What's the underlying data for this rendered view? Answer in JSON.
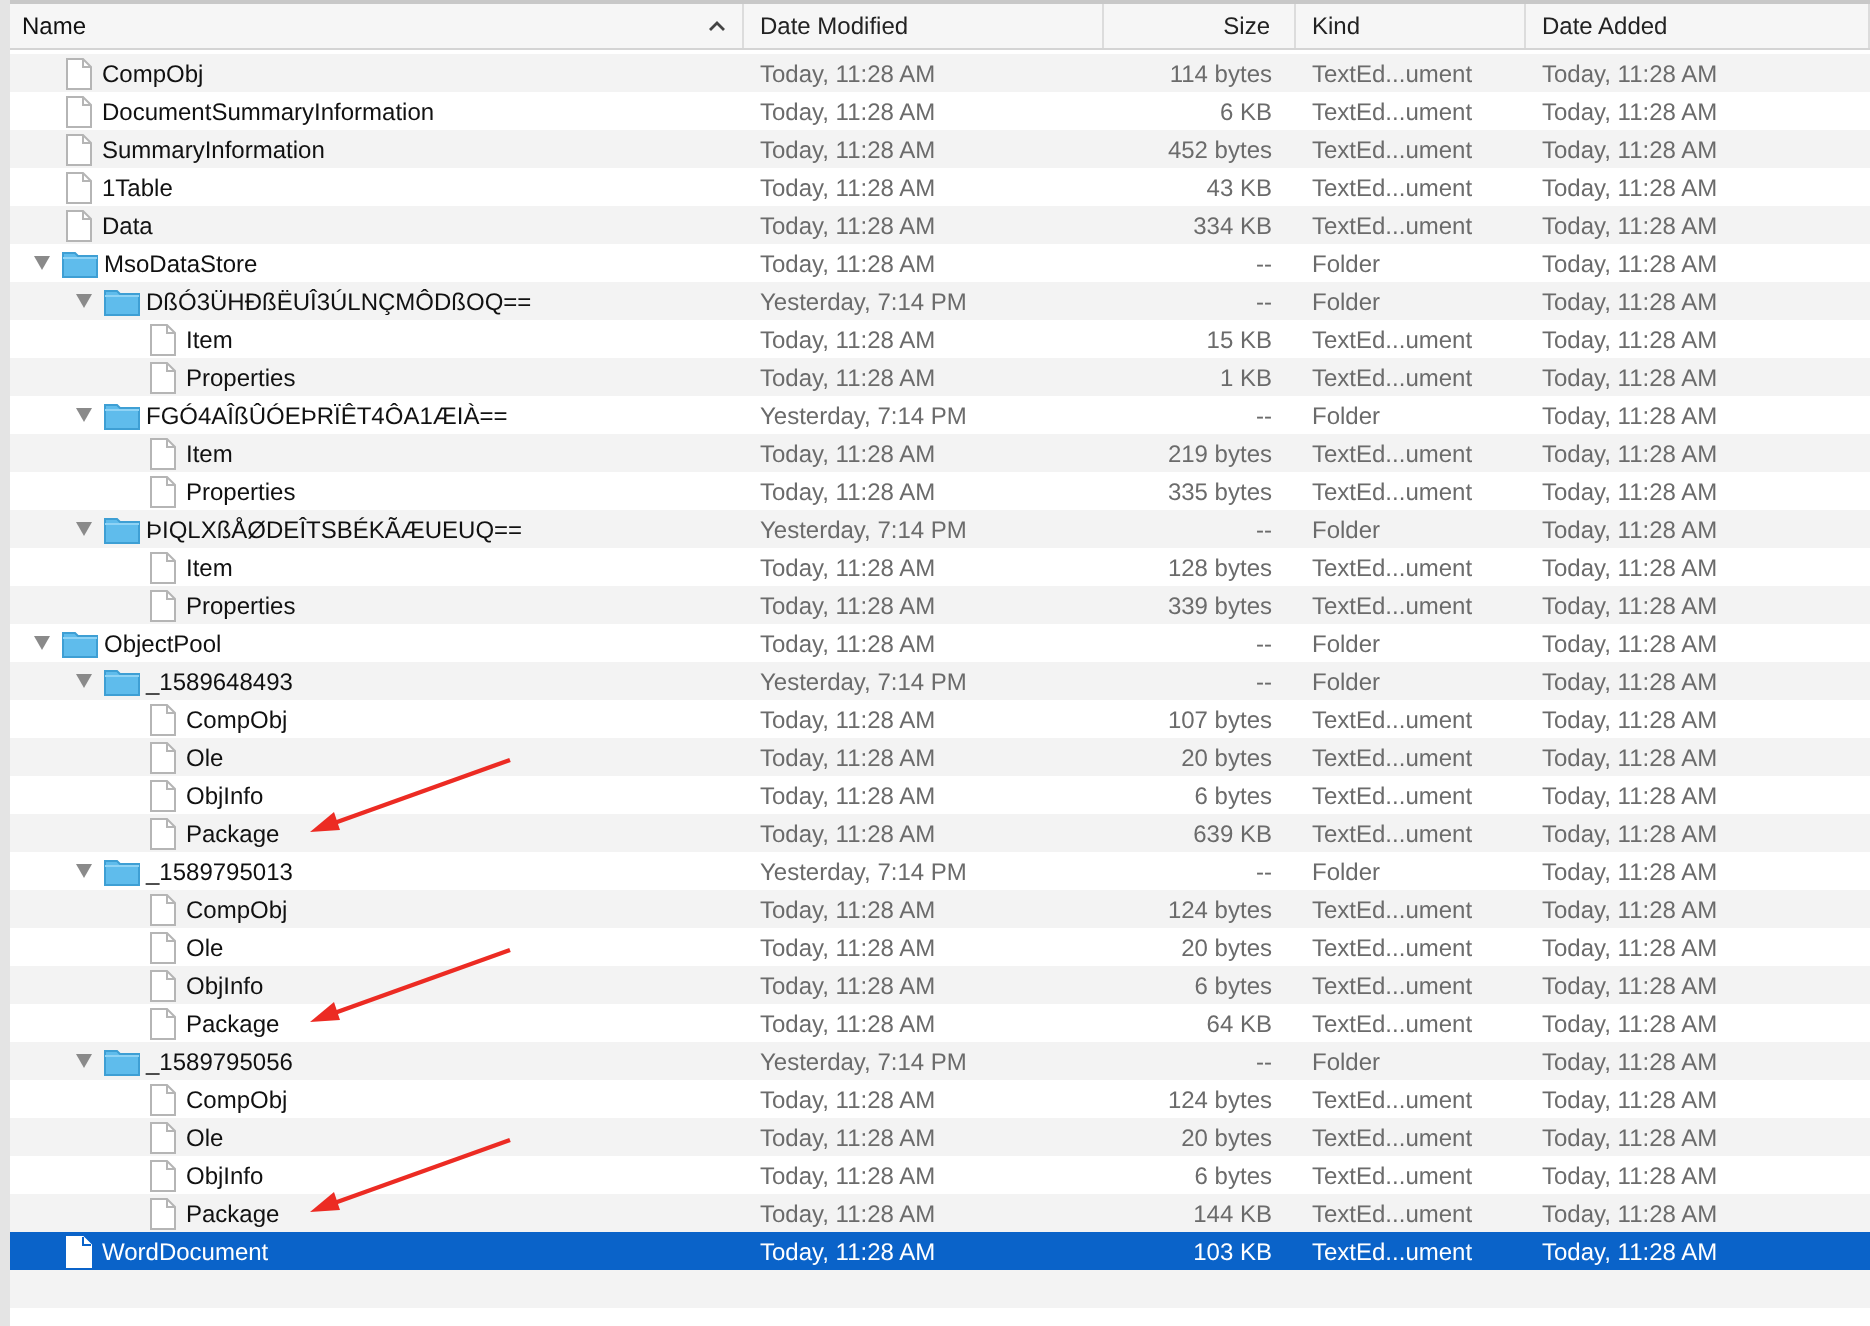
{
  "table": {
    "columns": [
      {
        "label": "Name",
        "sorted": true
      },
      {
        "label": "Date Modified",
        "sorted": false
      },
      {
        "label": "Size",
        "sorted": false
      },
      {
        "label": "Kind",
        "sorted": false
      },
      {
        "label": "Date Added",
        "sorted": false
      }
    ],
    "rows": [
      {
        "kind": "file",
        "name": "CompObj",
        "modified": "Today, 11:28 AM",
        "size": "114 bytes",
        "type": "TextEd...ument",
        "added": "Today, 11:28 AM",
        "selected": false
      },
      {
        "kind": "file",
        "name": "DocumentSummaryInformation",
        "modified": "Today, 11:28 AM",
        "size": "6 KB",
        "type": "TextEd...ument",
        "added": "Today, 11:28 AM",
        "selected": false
      },
      {
        "kind": "file",
        "name": "SummaryInformation",
        "modified": "Today, 11:28 AM",
        "size": "452 bytes",
        "type": "TextEd...ument",
        "added": "Today, 11:28 AM",
        "selected": false
      },
      {
        "kind": "file",
        "name": "1Table",
        "modified": "Today, 11:28 AM",
        "size": "43 KB",
        "type": "TextEd...ument",
        "added": "Today, 11:28 AM",
        "selected": false
      },
      {
        "kind": "file",
        "name": "Data",
        "modified": "Today, 11:28 AM",
        "size": "334 KB",
        "type": "TextEd...ument",
        "added": "Today, 11:28 AM",
        "selected": false
      },
      {
        "kind": "folder",
        "name": "MsoDataStore",
        "modified": "Today, 11:28 AM",
        "size": "--",
        "type": "Folder",
        "added": "Today, 11:28 AM",
        "selected": false,
        "expanded": true,
        "children": [
          {
            "kind": "folder",
            "name": "DßÓ3ÜHÐßËUÎ3ÚLNÇMÔDßOQ==",
            "modified": "Yesterday, 7:14 PM",
            "size": "--",
            "type": "Folder",
            "added": "Today, 11:28 AM",
            "selected": false,
            "expanded": true,
            "children": [
              {
                "kind": "file",
                "name": "Item",
                "modified": "Today, 11:28 AM",
                "size": "15 KB",
                "type": "TextEd...ument",
                "added": "Today, 11:28 AM",
                "selected": false
              },
              {
                "kind": "file",
                "name": "Properties",
                "modified": "Today, 11:28 AM",
                "size": "1 KB",
                "type": "TextEd...ument",
                "added": "Today, 11:28 AM",
                "selected": false
              }
            ]
          },
          {
            "kind": "folder",
            "name": "FGÓ4AÎßÛÓEÞRÏÊT4ÔA1ÆIÀ==",
            "modified": "Yesterday, 7:14 PM",
            "size": "--",
            "type": "Folder",
            "added": "Today, 11:28 AM",
            "selected": false,
            "expanded": true,
            "children": [
              {
                "kind": "file",
                "name": "Item",
                "modified": "Today, 11:28 AM",
                "size": "219 bytes",
                "type": "TextEd...ument",
                "added": "Today, 11:28 AM",
                "selected": false
              },
              {
                "kind": "file",
                "name": "Properties",
                "modified": "Today, 11:28 AM",
                "size": "335 bytes",
                "type": "TextEd...ument",
                "added": "Today, 11:28 AM",
                "selected": false
              }
            ]
          },
          {
            "kind": "folder",
            "name": "ÞIQLXßÅØDEÎTSBÉKÃÆUEUQ==",
            "modified": "Yesterday, 7:14 PM",
            "size": "--",
            "type": "Folder",
            "added": "Today, 11:28 AM",
            "selected": false,
            "expanded": true,
            "children": [
              {
                "kind": "file",
                "name": "Item",
                "modified": "Today, 11:28 AM",
                "size": "128 bytes",
                "type": "TextEd...ument",
                "added": "Today, 11:28 AM",
                "selected": false
              },
              {
                "kind": "file",
                "name": "Properties",
                "modified": "Today, 11:28 AM",
                "size": "339 bytes",
                "type": "TextEd...ument",
                "added": "Today, 11:28 AM",
                "selected": false
              }
            ]
          }
        ]
      },
      {
        "kind": "folder",
        "name": "ObjectPool",
        "modified": "Today, 11:28 AM",
        "size": "--",
        "type": "Folder",
        "added": "Today, 11:28 AM",
        "selected": false,
        "expanded": true,
        "children": [
          {
            "kind": "folder",
            "name": "_1589648493",
            "modified": "Yesterday, 7:14 PM",
            "size": "--",
            "type": "Folder",
            "added": "Today, 11:28 AM",
            "selected": false,
            "expanded": true,
            "children": [
              {
                "kind": "file",
                "name": "CompObj",
                "modified": "Today, 11:28 AM",
                "size": "107 bytes",
                "type": "TextEd...ument",
                "added": "Today, 11:28 AM",
                "selected": false
              },
              {
                "kind": "file",
                "name": "Ole",
                "modified": "Today, 11:28 AM",
                "size": "20 bytes",
                "type": "TextEd...ument",
                "added": "Today, 11:28 AM",
                "selected": false
              },
              {
                "kind": "file",
                "name": "ObjInfo",
                "modified": "Today, 11:28 AM",
                "size": "6 bytes",
                "type": "TextEd...ument",
                "added": "Today, 11:28 AM",
                "selected": false
              },
              {
                "kind": "file",
                "name": "Package",
                "modified": "Today, 11:28 AM",
                "size": "639 KB",
                "type": "TextEd...ument",
                "added": "Today, 11:28 AM",
                "selected": false,
                "arrow": true
              }
            ]
          },
          {
            "kind": "folder",
            "name": "_1589795013",
            "modified": "Yesterday, 7:14 PM",
            "size": "--",
            "type": "Folder",
            "added": "Today, 11:28 AM",
            "selected": false,
            "expanded": true,
            "children": [
              {
                "kind": "file",
                "name": "CompObj",
                "modified": "Today, 11:28 AM",
                "size": "124 bytes",
                "type": "TextEd...ument",
                "added": "Today, 11:28 AM",
                "selected": false
              },
              {
                "kind": "file",
                "name": "Ole",
                "modified": "Today, 11:28 AM",
                "size": "20 bytes",
                "type": "TextEd...ument",
                "added": "Today, 11:28 AM",
                "selected": false
              },
              {
                "kind": "file",
                "name": "ObjInfo",
                "modified": "Today, 11:28 AM",
                "size": "6 bytes",
                "type": "TextEd...ument",
                "added": "Today, 11:28 AM",
                "selected": false
              },
              {
                "kind": "file",
                "name": "Package",
                "modified": "Today, 11:28 AM",
                "size": "64 KB",
                "type": "TextEd...ument",
                "added": "Today, 11:28 AM",
                "selected": false,
                "arrow": true
              }
            ]
          },
          {
            "kind": "folder",
            "name": "_1589795056",
            "modified": "Yesterday, 7:14 PM",
            "size": "--",
            "type": "Folder",
            "added": "Today, 11:28 AM",
            "selected": false,
            "expanded": true,
            "children": [
              {
                "kind": "file",
                "name": "CompObj",
                "modified": "Today, 11:28 AM",
                "size": "124 bytes",
                "type": "TextEd...ument",
                "added": "Today, 11:28 AM",
                "selected": false
              },
              {
                "kind": "file",
                "name": "Ole",
                "modified": "Today, 11:28 AM",
                "size": "20 bytes",
                "type": "TextEd...ument",
                "added": "Today, 11:28 AM",
                "selected": false
              },
              {
                "kind": "file",
                "name": "ObjInfo",
                "modified": "Today, 11:28 AM",
                "size": "6 bytes",
                "type": "TextEd...ument",
                "added": "Today, 11:28 AM",
                "selected": false
              },
              {
                "kind": "file",
                "name": "Package",
                "modified": "Today, 11:28 AM",
                "size": "144 KB",
                "type": "TextEd...ument",
                "added": "Today, 11:28 AM",
                "selected": false,
                "arrow": true
              }
            ]
          }
        ]
      },
      {
        "kind": "file",
        "name": "WordDocument",
        "modified": "Today, 11:28 AM",
        "size": "103 KB",
        "type": "TextEd...ument",
        "added": "Today, 11:28 AM",
        "selected": true
      }
    ]
  }
}
